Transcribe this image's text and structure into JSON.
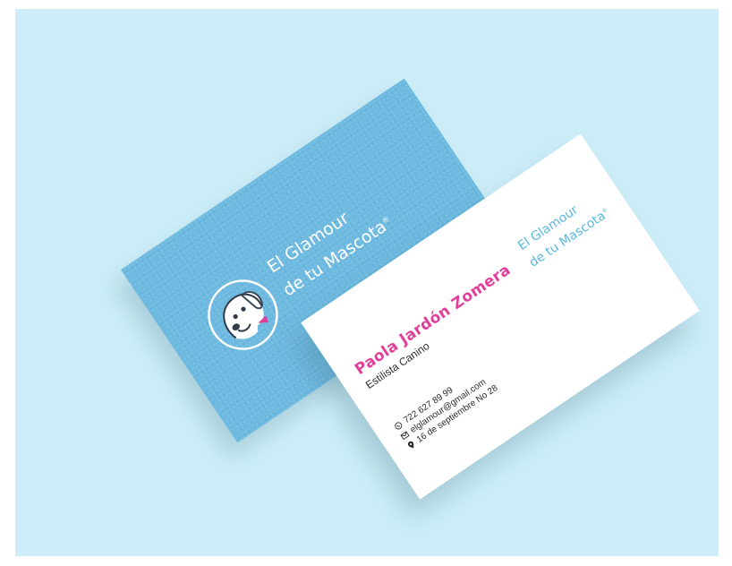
{
  "colors": {
    "background": "#cdeef8",
    "card_blue": "#6db9e0",
    "card_white": "#ffffff",
    "name_pink": "#e0409a",
    "brand_blue": "#5ab8e0"
  },
  "back_card": {
    "brand_line1": "El Glamour",
    "brand_line2": "de tu Mascota",
    "registered_mark": "®",
    "logo_icon": "dog-head-icon"
  },
  "front_card": {
    "name": "Paola Jardón Zomera",
    "role": "Estilista Canino",
    "phone_icon": "whatsapp-icon",
    "phone": "722 627 89 99",
    "email_icon": "mail-icon",
    "email": "elglamour@gmail.com",
    "address_icon": "location-pin-icon",
    "address": "16 de septiembre No 28",
    "brand_line1": "El Glamour",
    "brand_line2": "de tu Mascota",
    "registered_mark": "®"
  }
}
